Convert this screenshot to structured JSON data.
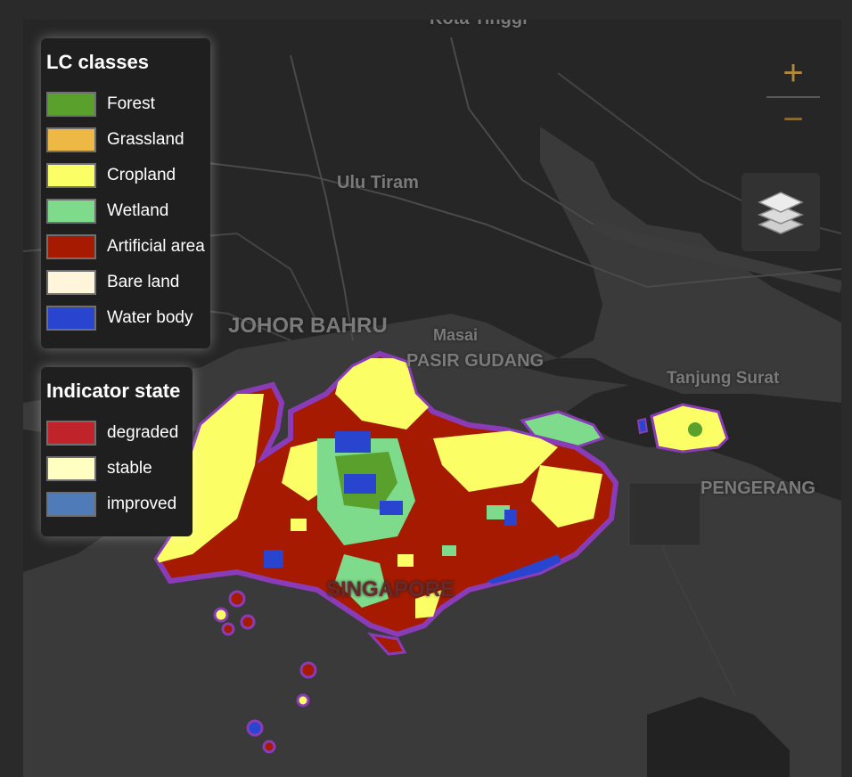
{
  "map": {
    "place_labels": [
      {
        "id": "kota-tinggi",
        "text": "Kota Tinggi"
      },
      {
        "id": "ulu-tiram",
        "text": "Ulu Tiram"
      },
      {
        "id": "johor-bahru",
        "text": "JOHOR BAHRU"
      },
      {
        "id": "masai",
        "text": "Masai"
      },
      {
        "id": "pasir-gudang",
        "text": "PASIR GUDANG"
      },
      {
        "id": "tanjung-surat",
        "text": "Tanjung Surat"
      },
      {
        "id": "pengerang",
        "text": "PENGERANG"
      },
      {
        "id": "singapore",
        "text": "SINGAPORE"
      }
    ]
  },
  "lc_legend": {
    "title": "LC classes",
    "items": [
      {
        "label": "Forest",
        "color": "#5aa02c"
      },
      {
        "label": "Grassland",
        "color": "#eeb844"
      },
      {
        "label": "Cropland",
        "color": "#fbfe65"
      },
      {
        "label": "Wetland",
        "color": "#7ddb8b"
      },
      {
        "label": "Artificial area",
        "color": "#a51a00"
      },
      {
        "label": "Bare land",
        "color": "#fff5db"
      },
      {
        "label": "Water body",
        "color": "#2945d0"
      }
    ]
  },
  "indicator_legend": {
    "title": "Indicator state",
    "items": [
      {
        "label": "degraded",
        "color": "#c0232a"
      },
      {
        "label": "stable",
        "color": "#ffffc2"
      },
      {
        "label": "improved",
        "color": "#4f7bb9"
      }
    ]
  },
  "controls": {
    "zoom_in": "+",
    "zoom_out": "−",
    "layers_icon": "layers-icon"
  }
}
